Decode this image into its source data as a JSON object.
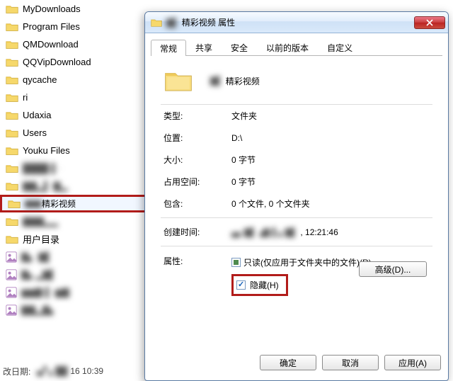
{
  "explorer": {
    "items": [
      {
        "label": "MyDownloads",
        "type": "folder"
      },
      {
        "label": "Program Files",
        "type": "folder"
      },
      {
        "label": "QMDownload",
        "type": "folder"
      },
      {
        "label": "QQVipDownload",
        "type": "folder"
      },
      {
        "label": "qycache",
        "type": "folder"
      },
      {
        "label": "ri",
        "type": "folder"
      },
      {
        "label": "Udaxia",
        "type": "folder"
      },
      {
        "label": "Users",
        "type": "folder"
      },
      {
        "label": "Youku Files",
        "type": "folder"
      },
      {
        "label": "████·▌·",
        "type": "folder",
        "blur": true
      },
      {
        "label": "▇▇▂▌·▇▂",
        "type": "folder",
        "blur": true
      },
      {
        "label": "▇▇精彩视频",
        "type": "folder",
        "selected": true,
        "partial_blur": true
      },
      {
        "label": "▇▇▇▂▂",
        "type": "folder",
        "blur": true
      },
      {
        "label": "用户目录",
        "type": "folder"
      },
      {
        "label": "▇▖·▇▌",
        "type": "image",
        "blur": true
      },
      {
        "label": "▇▖▂▇▌",
        "type": "image",
        "blur": true
      },
      {
        "label": "▆▆▇·▌·▆▇",
        "type": "image",
        "blur": true
      },
      {
        "label": "▇▇▂▇▖",
        "type": "image",
        "blur": true
      }
    ],
    "status_prefix": "改日期:",
    "status_blur": "▗▞ ▖██",
    "status_time": "16 10:39"
  },
  "dialog": {
    "title_blur": "▇▌",
    "title_rest": "精彩视频 属性",
    "tabs": [
      "常规",
      "共享",
      "安全",
      "以前的版本",
      "自定义"
    ],
    "folder_name_blur": "▇▌",
    "folder_name_rest": "精彩视频",
    "fields": {
      "type_label": "类型:",
      "type_value": "文件夹",
      "location_label": "位置:",
      "location_value": "D:\\",
      "size_label": "大小:",
      "size_value": "0 字节",
      "sizeondisk_label": "占用空间:",
      "sizeondisk_value": "0 字节",
      "contains_label": "包含:",
      "contains_value": "0 个文件, 0 个文件夹",
      "created_label": "创建时间:",
      "created_blur": "▄▖▇▌▗▇·▌▖▇▌",
      "created_rest": ", 12:21:46",
      "attr_label": "属性:",
      "readonly_text": "只读(仅应用于文件夹中的文件)(R)",
      "hidden_text": "隐藏(H)"
    },
    "buttons": {
      "advanced": "高级(D)...",
      "ok": "确定",
      "cancel": "取消",
      "apply": "应用(A)"
    }
  }
}
